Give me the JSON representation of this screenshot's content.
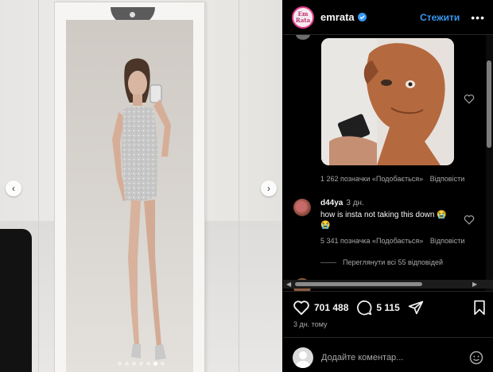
{
  "post": {
    "username": "emrata",
    "avatar_text": "Em Rata",
    "follow_label": "Стежити",
    "more_label": "•••",
    "likes_count": "701 488",
    "comments_count": "5 115",
    "posted_ago": "3 дн. тому"
  },
  "comments": [
    {
      "kind": "gif",
      "likes_line": "1 262 позначки «Подобається»",
      "reply_label": "Відповісти"
    },
    {
      "user": "d44ya",
      "time": "3 дн.",
      "text": "how is insta not taking this down 😭😭",
      "likes_line": "5 341 позначка «Подобається»",
      "reply_label": "Відповісти",
      "view_replies": "Переглянути всі 55 відповідей"
    }
  ],
  "add_comment": {
    "placeholder": "Додайте коментар..."
  },
  "carousel": {
    "dots": 7,
    "active_dot": 5
  },
  "colors": {
    "accent": "#3897f0",
    "verified": "#3897f0",
    "background": "#000000",
    "muted": "#a8a8a8"
  },
  "icons": [
    "heart-icon",
    "comment-icon",
    "share-icon",
    "bookmark-icon",
    "emoji-icon",
    "verified-icon",
    "chevron-left-icon",
    "chevron-right-icon"
  ]
}
